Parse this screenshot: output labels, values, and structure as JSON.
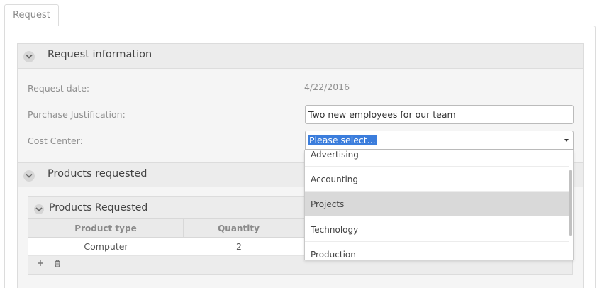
{
  "tab": {
    "label": "Request"
  },
  "request_info": {
    "title": "Request information",
    "request_date_label": "Request date:",
    "request_date_value": "4/22/2016",
    "justification_label": "Purchase Justification:",
    "justification_value": "Two new employees for our team",
    "cost_center_label": "Cost Center:",
    "cost_center_selected": "Please select...",
    "cost_center_options": [
      "Advertising",
      "Accounting",
      "Projects",
      "Technology",
      "Production"
    ],
    "highlighted_option": "Projects"
  },
  "products_section": {
    "title": "Products requested",
    "grid": {
      "title": "Products Requested",
      "columns": [
        "Product type",
        "Quantity"
      ],
      "rows": [
        {
          "product_type": "Computer",
          "quantity": "2"
        }
      ],
      "add_icon": "plus-icon",
      "delete_icon": "trash-icon"
    }
  }
}
